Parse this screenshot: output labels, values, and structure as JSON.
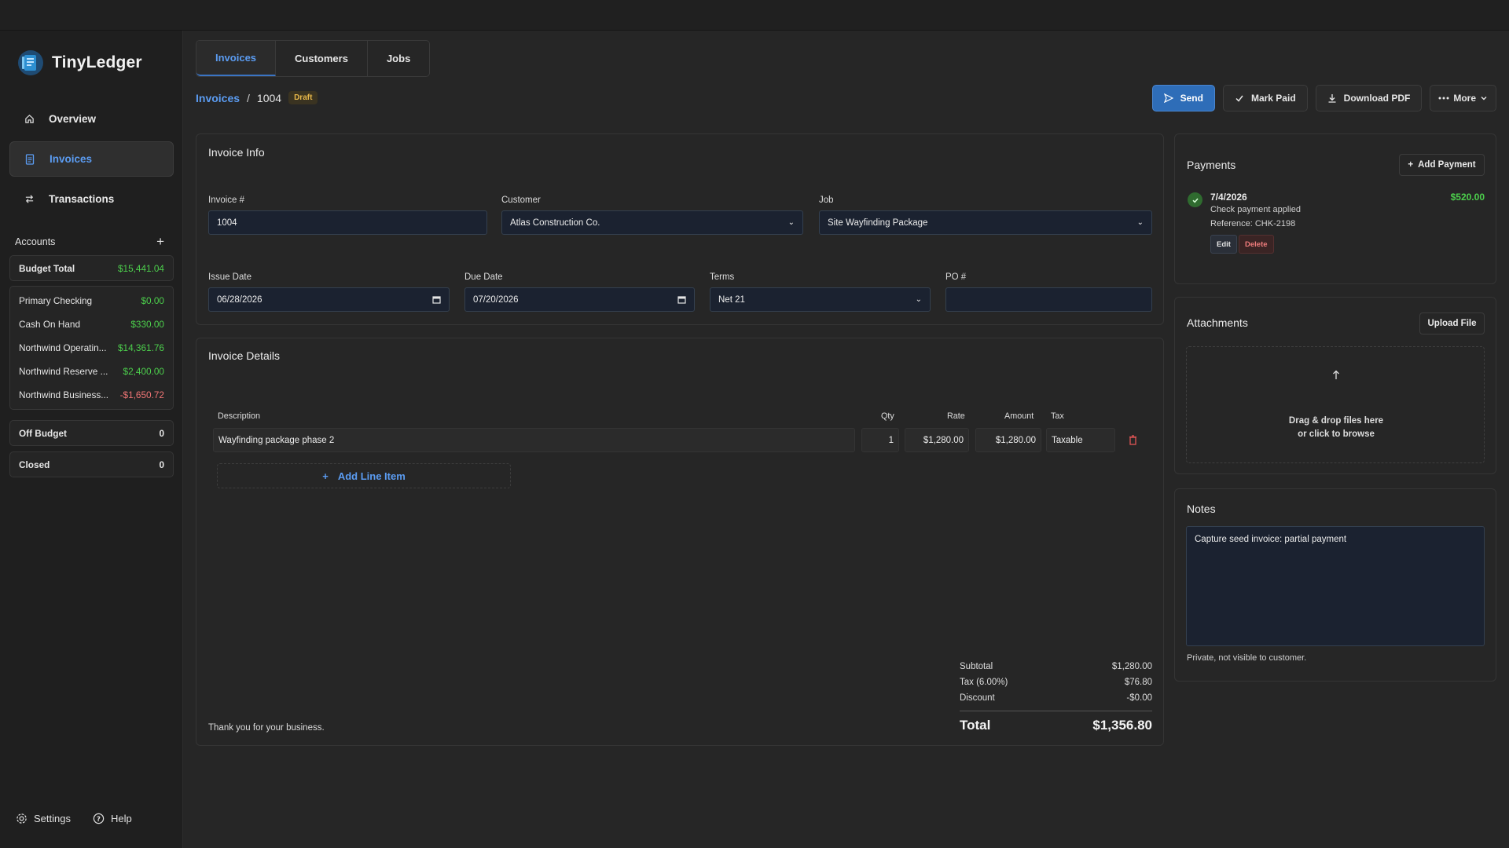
{
  "app": {
    "name": "TinyLedger"
  },
  "nav": [
    {
      "label": "Overview",
      "icon": "home-icon"
    },
    {
      "label": "Invoices",
      "icon": "document-icon"
    },
    {
      "label": "Transactions",
      "icon": "transfer-icon"
    }
  ],
  "accounts": {
    "heading": "Accounts",
    "add_symbol": "+",
    "budget_total": {
      "label": "Budget Total",
      "amount": "$15,441.04"
    },
    "items": [
      {
        "name": "Primary Checking",
        "amount": "$0.00"
      },
      {
        "name": "Cash On Hand",
        "amount": "$330.00"
      },
      {
        "name": "Northwind Operatin...",
        "amount": "$14,361.76"
      },
      {
        "name": "Northwind Reserve ...",
        "amount": "$2,400.00"
      },
      {
        "name": "Northwind Business...",
        "amount": "-$1,650.72"
      }
    ],
    "off_budget": {
      "label": "Off Budget",
      "count": "0"
    },
    "closed": {
      "label": "Closed",
      "count": "0"
    }
  },
  "footer": {
    "settings": "Settings",
    "help": "Help"
  },
  "tabs": [
    "Invoices",
    "Customers",
    "Jobs"
  ],
  "breadcrumb": {
    "root": "Invoices",
    "sep": "/",
    "current": "1004",
    "status": "Draft"
  },
  "actions": {
    "send": "Send",
    "mark_paid": "Mark Paid",
    "download": "Download PDF",
    "more": "More"
  },
  "invoice_info": {
    "title": "Invoice Info",
    "invoice_no_label": "Invoice #",
    "invoice_no": "1004",
    "customer_label": "Customer",
    "customer": "Atlas Construction Co.",
    "job_label": "Job",
    "job": "Site Wayfinding Package",
    "issue_label": "Issue Date",
    "issue": "06/28/2026",
    "due_label": "Due Date",
    "due": "07/20/2026",
    "terms_label": "Terms",
    "terms": "Net 21",
    "po_label": "PO #",
    "po": ""
  },
  "details": {
    "title": "Invoice Details",
    "headers": {
      "description": "Description",
      "qty": "Qty",
      "rate": "Rate",
      "amount": "Amount",
      "tax": "Tax"
    },
    "line": {
      "description": "Wayfinding package phase 2",
      "qty": "1",
      "rate": "$1,280.00",
      "amount": "$1,280.00",
      "tax": "Taxable"
    },
    "add_line": "Add Line Item",
    "add_symbol": "+",
    "footer_note": "Thank you for your business.",
    "subtotal_label": "Subtotal",
    "subtotal": "$1,280.00",
    "tax_label": "Tax (6.00%)",
    "tax": "$76.80",
    "discount_label": "Discount",
    "discount": "-$0.00",
    "total_label": "Total",
    "total": "$1,356.80"
  },
  "payments": {
    "title": "Payments",
    "add_label": "Add Payment",
    "add_symbol": "+",
    "item": {
      "date": "7/4/2026",
      "desc": "Check payment applied",
      "ref": "Reference: CHK-2198",
      "amount": "$520.00",
      "edit": "Edit",
      "delete": "Delete"
    }
  },
  "attachments": {
    "title": "Attachments",
    "upload": "Upload File",
    "drop1": "Drag & drop files here",
    "drop2": "or click to browse"
  },
  "notes": {
    "title": "Notes",
    "text": "Capture seed invoice: partial payment",
    "hint": "Private, not visible to customer."
  },
  "colors": {
    "accent": "#5b9cf2",
    "positive": "#4ccf4c",
    "negative": "#f07575",
    "draft": "#e8b84a"
  }
}
